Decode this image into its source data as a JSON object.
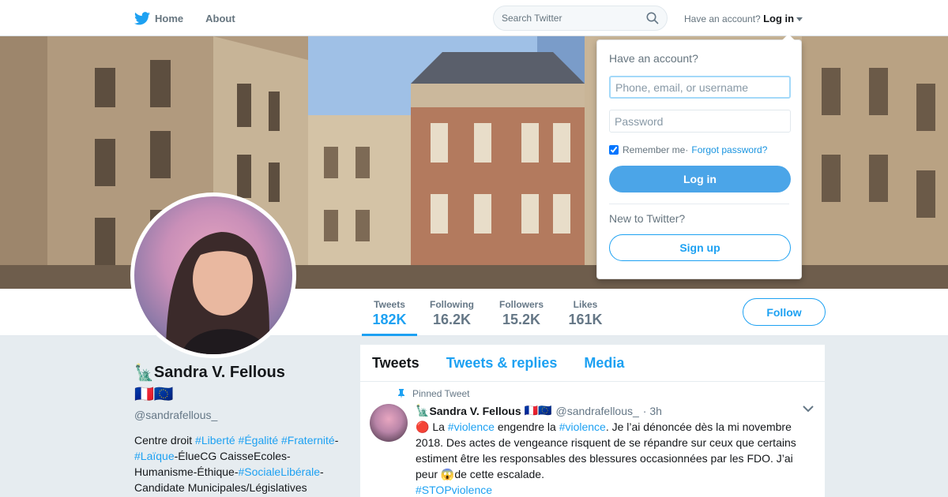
{
  "nav": {
    "home_label": "Home",
    "about_label": "About",
    "search_placeholder": "Search Twitter",
    "account_prompt": "Have an account?",
    "login_label": "Log in"
  },
  "profile_nav": {
    "stats": [
      {
        "label": "Tweets",
        "value": "182K"
      },
      {
        "label": "Following",
        "value": "16.2K"
      },
      {
        "label": "Followers",
        "value": "15.2K"
      },
      {
        "label": "Likes",
        "value": "161K"
      }
    ],
    "follow_label": "Follow"
  },
  "profile": {
    "name_emoji": "🗽",
    "name": "Sandra V. Fellous",
    "flags": "🇫🇷🇪🇺",
    "handle": "@sandrafellous_",
    "bio": [
      {
        "t": "Centre droit ",
        "h": false
      },
      {
        "t": "#Liberté",
        "h": true
      },
      {
        "t": " ",
        "h": false
      },
      {
        "t": "#Égalité",
        "h": true
      },
      {
        "t": " ",
        "h": false
      },
      {
        "t": "#Fraternité",
        "h": true
      },
      {
        "t": "-",
        "h": false
      },
      {
        "t": "#Laïque",
        "h": true
      },
      {
        "t": "-ÉlueCG CaisseEcoles-Humanisme-Éthique-",
        "h": false
      },
      {
        "t": "#SocialeLibérale",
        "h": true
      },
      {
        "t": "-Candidate Municipales/Législatives",
        "h": false
      }
    ]
  },
  "timeline": {
    "tabs": [
      "Tweets",
      "Tweets & replies",
      "Media"
    ],
    "tweet": {
      "pinned_label": "Pinned Tweet",
      "author_emoji": "🗽",
      "author": "Sandra V. Fellous",
      "author_flags": "🇫🇷🇪🇺",
      "handle": "@sandrafellous_",
      "time": "· 3h",
      "text": [
        {
          "t": "🔴 La ",
          "h": false
        },
        {
          "t": "#violence",
          "h": true
        },
        {
          "t": " engendre la ",
          "h": false
        },
        {
          "t": "#violence",
          "h": true
        },
        {
          "t": ". Je l’ai dénoncée dès la mi novembre 2018. Des actes de vengeance risquent de se répandre sur ceux que certains estiment être les responsables des blessures occasionnées par les FDO. J’ai peur 😱de cette escalade.",
          "h": false
        },
        {
          "t": "\n",
          "h": false
        },
        {
          "t": "#STOPviolence",
          "h": true
        }
      ]
    }
  },
  "login_dropdown": {
    "title": "Have an account?",
    "username_placeholder": "Phone, email, or username",
    "password_placeholder": "Password",
    "remember_label": "Remember me",
    "separator": " · ",
    "forgot_label": "Forgot password?",
    "login_button": "Log in",
    "new_prompt": "New to Twitter?",
    "signup_button": "Sign up"
  },
  "colors": {
    "accent": "#1da1f2",
    "background": "#e6ecf0",
    "login_button": "#4ba5e8"
  }
}
